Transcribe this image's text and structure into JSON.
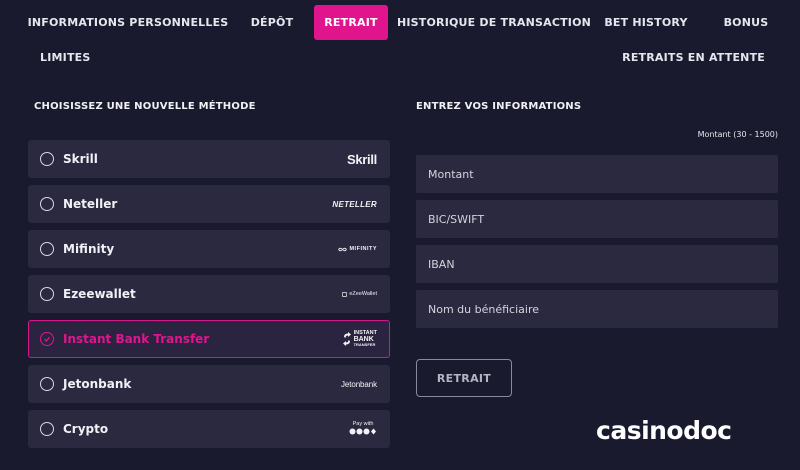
{
  "nav": {
    "tabs": [
      {
        "label": "INFORMATIONS PERSONNELLES",
        "active": false
      },
      {
        "label": "DÉPÔT",
        "active": false
      },
      {
        "label": "RETRAIT",
        "active": true
      },
      {
        "label": "HISTORIQUE DE TRANSACTION",
        "active": false
      },
      {
        "label": "BET HISTORY",
        "active": false
      },
      {
        "label": "BONUS",
        "active": false
      },
      {
        "label": "LIMITES",
        "active": false
      },
      {
        "label": "RETRAITS EN ATTENTE",
        "active": false
      }
    ],
    "active_color": "#e0158d"
  },
  "methods_section": {
    "title": "CHOISISSEZ UNE NOUVELLE MÉTHODE",
    "selected": "Instant Bank Transfer",
    "items": [
      {
        "label": "Skrill",
        "logo_text": "Skrill",
        "icon": "skrill-logo"
      },
      {
        "label": "Neteller",
        "logo_text": "NETELLER",
        "icon": "neteller-logo"
      },
      {
        "label": "Mifinity",
        "logo_text": "MIFINITY",
        "icon": "mifinity-logo"
      },
      {
        "label": "Ezeewallet",
        "logo_text": "eZeeWallet",
        "icon": "ezeewallet-logo"
      },
      {
        "label": "Instant Bank Transfer",
        "logo_text": [
          "INSTANT",
          "BANK",
          "TRANSFER"
        ],
        "icon": "instant-bank-transfer-logo"
      },
      {
        "label": "Jetonbank",
        "logo_text": "Jetonbank",
        "icon": "jetonbank-logo"
      },
      {
        "label": "Crypto",
        "logo_text": "Pay with",
        "icon": "crypto-logo"
      }
    ]
  },
  "info_section": {
    "title": "ENTREZ VOS INFORMATIONS",
    "amount_hint": "Montant (30 - 1500)",
    "fields": [
      {
        "placeholder": "Montant",
        "value": ""
      },
      {
        "placeholder": "BIC/SWIFT",
        "value": ""
      },
      {
        "placeholder": "IBAN",
        "value": ""
      },
      {
        "placeholder": "Nom du bénéficiaire",
        "value": ""
      }
    ],
    "submit_label": "RETRAIT"
  },
  "brand": {
    "text": "casinodoc"
  },
  "colors": {
    "background": "#1a1a2e",
    "panel": "#2a2940",
    "accent": "#e0158d"
  }
}
